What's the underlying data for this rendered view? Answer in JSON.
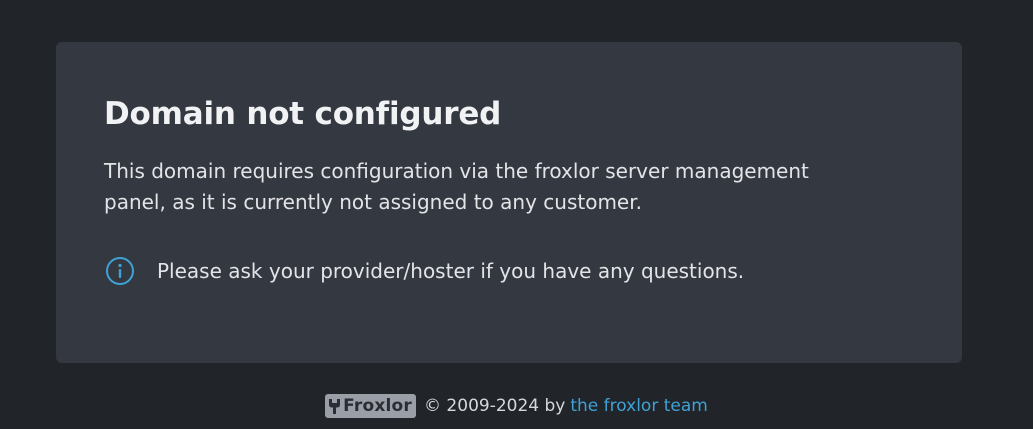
{
  "card": {
    "title": "Domain not configured",
    "description": "This domain requires configuration via the froxlor server management panel, as it is currently not assigned to any customer.",
    "notice": "Please ask your provider/hoster if you have any questions.",
    "notice_icon": "info-icon"
  },
  "footer": {
    "logo_text": "Froxlor",
    "copyright": "© 2009-2024 by",
    "team_link": "the froxlor team"
  },
  "colors": {
    "background": "#212429",
    "card": "#343840",
    "accent": "#3fa2d6"
  }
}
